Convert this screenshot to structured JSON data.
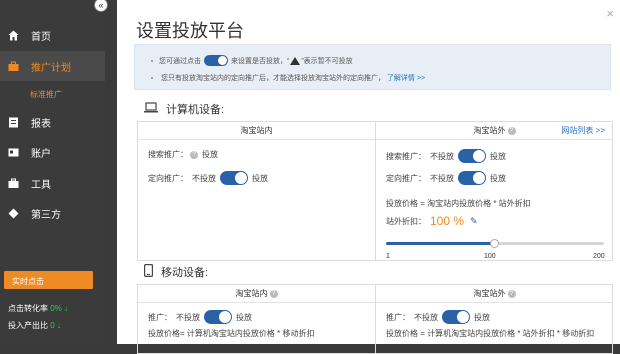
{
  "sidebar": {
    "collapse_glyph": "«",
    "items": [
      {
        "label": "首页",
        "icon": "home-icon"
      },
      {
        "label": "推广计划",
        "icon": "briefcase-icon"
      },
      {
        "label": "报表",
        "icon": "report-icon"
      },
      {
        "label": "账户",
        "icon": "account-card-icon"
      },
      {
        "label": "工具",
        "icon": "toolbox-icon"
      },
      {
        "label": "第三方",
        "icon": "third-party-icon"
      }
    ],
    "sub_item": "标准推广",
    "realtime_label": "实时点击",
    "stats": [
      {
        "label": "点击转化率",
        "value": "0%",
        "arrow": "↓"
      },
      {
        "label": "投入产出比",
        "value": "0",
        "arrow": "↓"
      }
    ]
  },
  "modal": {
    "title": "设置投放平台",
    "close_glyph": "×",
    "info": {
      "line1_pre": "您可通过点击",
      "line1_mid": "来设置是否投放，“",
      "line1_post": "”表示暂不可投放",
      "line2_pre": "您只有投放淘宝站内的定向推广后，才能选择投放淘宝站外的定向推广，",
      "line2_link": "了解详情 >>"
    },
    "computer": {
      "title": "计算机设备:",
      "left_header": "淘宝站内",
      "right_header": "淘宝站外",
      "site_list_link": "网站列表 >>",
      "left_rows": [
        {
          "label": "搜索推广：",
          "off": "",
          "on": "投放"
        },
        {
          "label": "定向推广：",
          "off": "不投放",
          "on": "投放"
        }
      ],
      "right_rows": [
        {
          "label": "搜索推广：",
          "off": "不投放",
          "on": "投放"
        },
        {
          "label": "定向推广：",
          "off": "不投放",
          "on": "投放"
        }
      ],
      "formula": "投放价格 = 淘宝站内投放价格 * 站外折扣",
      "discount_label": "站外折扣：",
      "discount_value": "100 %",
      "slider": {
        "min": "1",
        "mid": "100",
        "max": "200",
        "min_v": 1,
        "max_v": 200,
        "value": 100
      }
    },
    "mobile": {
      "title": "移动设备:",
      "left_header": "淘宝站内",
      "right_header": "淘宝站外",
      "left_row": {
        "label": "推广：",
        "off": "不投放",
        "on": "投放"
      },
      "right_row": {
        "label": "推广：",
        "off": "不投放",
        "on": "投放"
      },
      "left_formula": "投放价格= 计算机淘宝站内投放价格 * 移动折扣",
      "right_formula": "投放价格 = 计算机淘宝站内投放价格 * 站外折扣 * 移动折扣"
    }
  }
}
